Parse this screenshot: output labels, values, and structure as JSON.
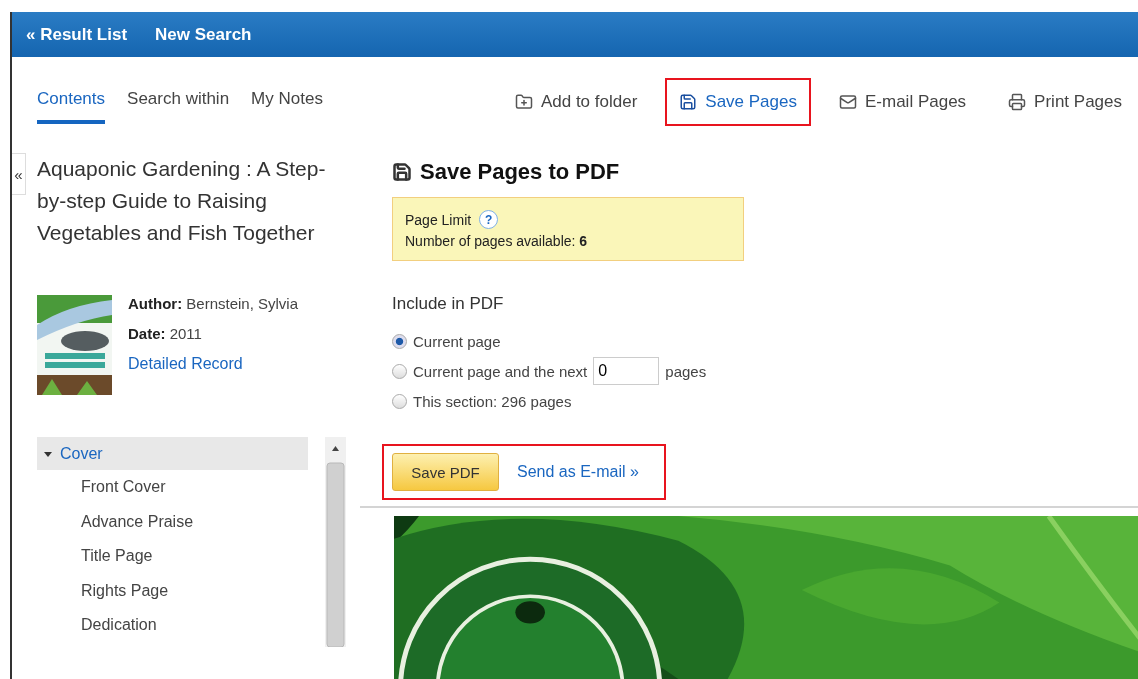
{
  "nav": [
    {
      "label": "« Result List"
    },
    {
      "label": "New Search"
    }
  ],
  "tabs": [
    {
      "label": "Contents",
      "selected": true
    },
    {
      "label": "Search within",
      "selected": false
    },
    {
      "label": "My Notes",
      "selected": false
    }
  ],
  "toolbar": [
    {
      "label": "Add to folder",
      "kind": "folder",
      "highlighted": false
    },
    {
      "label": "Save Pages",
      "kind": "save",
      "highlighted": true
    },
    {
      "label": "E-mail Pages",
      "kind": "mail",
      "highlighted": false
    },
    {
      "label": "Print Pages",
      "kind": "print",
      "highlighted": false
    }
  ],
  "collapse_button": "«",
  "book": {
    "title": "Aquaponic Gardening : A Step-by-step Guide to Raising Vegetables and Fish Together",
    "author_label": "Author:",
    "author": "Bernstein, Sylvia",
    "date_label": "Date:",
    "date": "2011",
    "link": "Detailed Record"
  },
  "toc": [
    {
      "label": "Cover",
      "expanded": true,
      "selected": true,
      "children": [
        {
          "label": "Front Cover"
        },
        {
          "label": "Advance Praise"
        },
        {
          "label": "Title Page"
        },
        {
          "label": "Rights Page"
        },
        {
          "label": "Dedication"
        }
      ]
    }
  ],
  "panel": {
    "title": "Save Pages to PDF",
    "notice": {
      "title": "Page Limit",
      "help": "?",
      "text": "Number of pages available: **6**"
    },
    "include_label": "Include in PDF",
    "options": [
      {
        "kind": "plain",
        "label": "Current page",
        "selected": true
      },
      {
        "kind": "count",
        "label": "Current page and the next",
        "value": "0",
        "suffix": "pages",
        "selected": false
      },
      {
        "kind": "plain",
        "label": "This section: 296 pages",
        "selected": false
      }
    ],
    "actions": {
      "highlighted": true,
      "primary": "Save PDF",
      "link": "Send as E-mail »"
    }
  }
}
